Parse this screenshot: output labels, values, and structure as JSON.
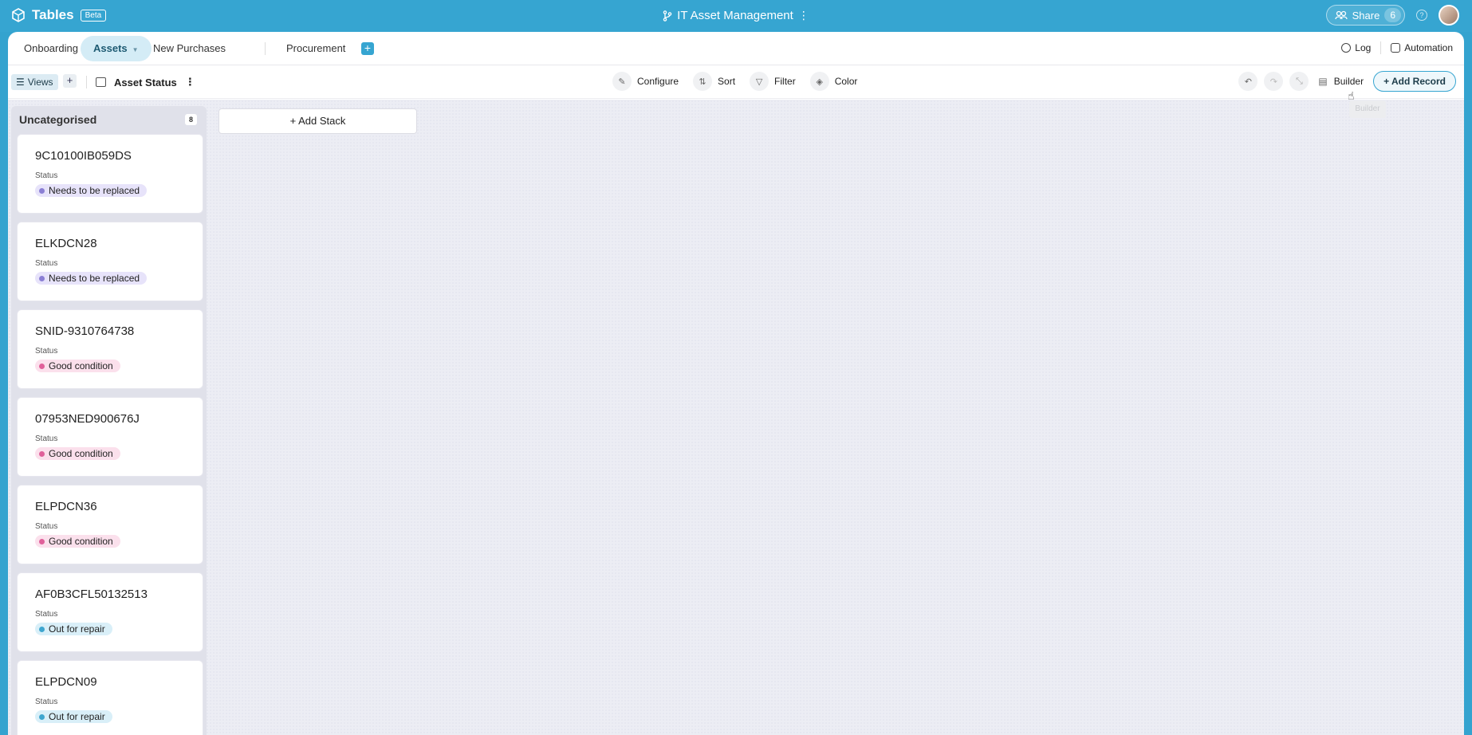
{
  "app": {
    "name": "Tables",
    "badge": "Beta",
    "title": "IT Asset Management",
    "title_menu": "⋮",
    "share_label": "Share",
    "share_count": "6",
    "help": "?"
  },
  "tabs": {
    "items": [
      {
        "label": "Onboarding"
      },
      {
        "label": "Assets",
        "active": true
      },
      {
        "label": "New Purchases"
      },
      {
        "label": "Procurement"
      }
    ],
    "add": "+",
    "log_label": "Log",
    "automation_label": "Automation"
  },
  "toolbar": {
    "views_label": "Views",
    "views_add": "+",
    "view_name": "Asset Status",
    "view_menu": "⋮",
    "configure_label": "Configure",
    "sort_label": "Sort",
    "filter_label": "Filter",
    "color_label": "Color",
    "builder_label": "Builder",
    "builder_tooltip": "Builder",
    "add_record_label": "+ Add Record"
  },
  "colors": {
    "accent": "#36a5d1",
    "status_purple": "#8b7fd4",
    "status_pink": "#e0609a",
    "status_blue": "#3fa6cf"
  },
  "board": {
    "stack": {
      "name": "Uncategorised",
      "count": "8",
      "field_label": "Status",
      "cards": [
        {
          "title": "9C10100IB059DS",
          "status": "Needs to be replaced",
          "tone": "purple"
        },
        {
          "title": "ELKDCN28",
          "status": "Needs to be replaced",
          "tone": "purple"
        },
        {
          "title": "SNID-9310764738",
          "status": "Good condition",
          "tone": "pink"
        },
        {
          "title": "07953NED900676J",
          "status": "Good condition",
          "tone": "pink"
        },
        {
          "title": "ELPDCN36",
          "status": "Good condition",
          "tone": "pink"
        },
        {
          "title": "AF0B3CFL50132513",
          "status": "Out for repair",
          "tone": "blue"
        },
        {
          "title": "ELPDCN09",
          "status": "Out for repair",
          "tone": "blue"
        }
      ]
    },
    "add_stack_label": "+ Add Stack"
  }
}
